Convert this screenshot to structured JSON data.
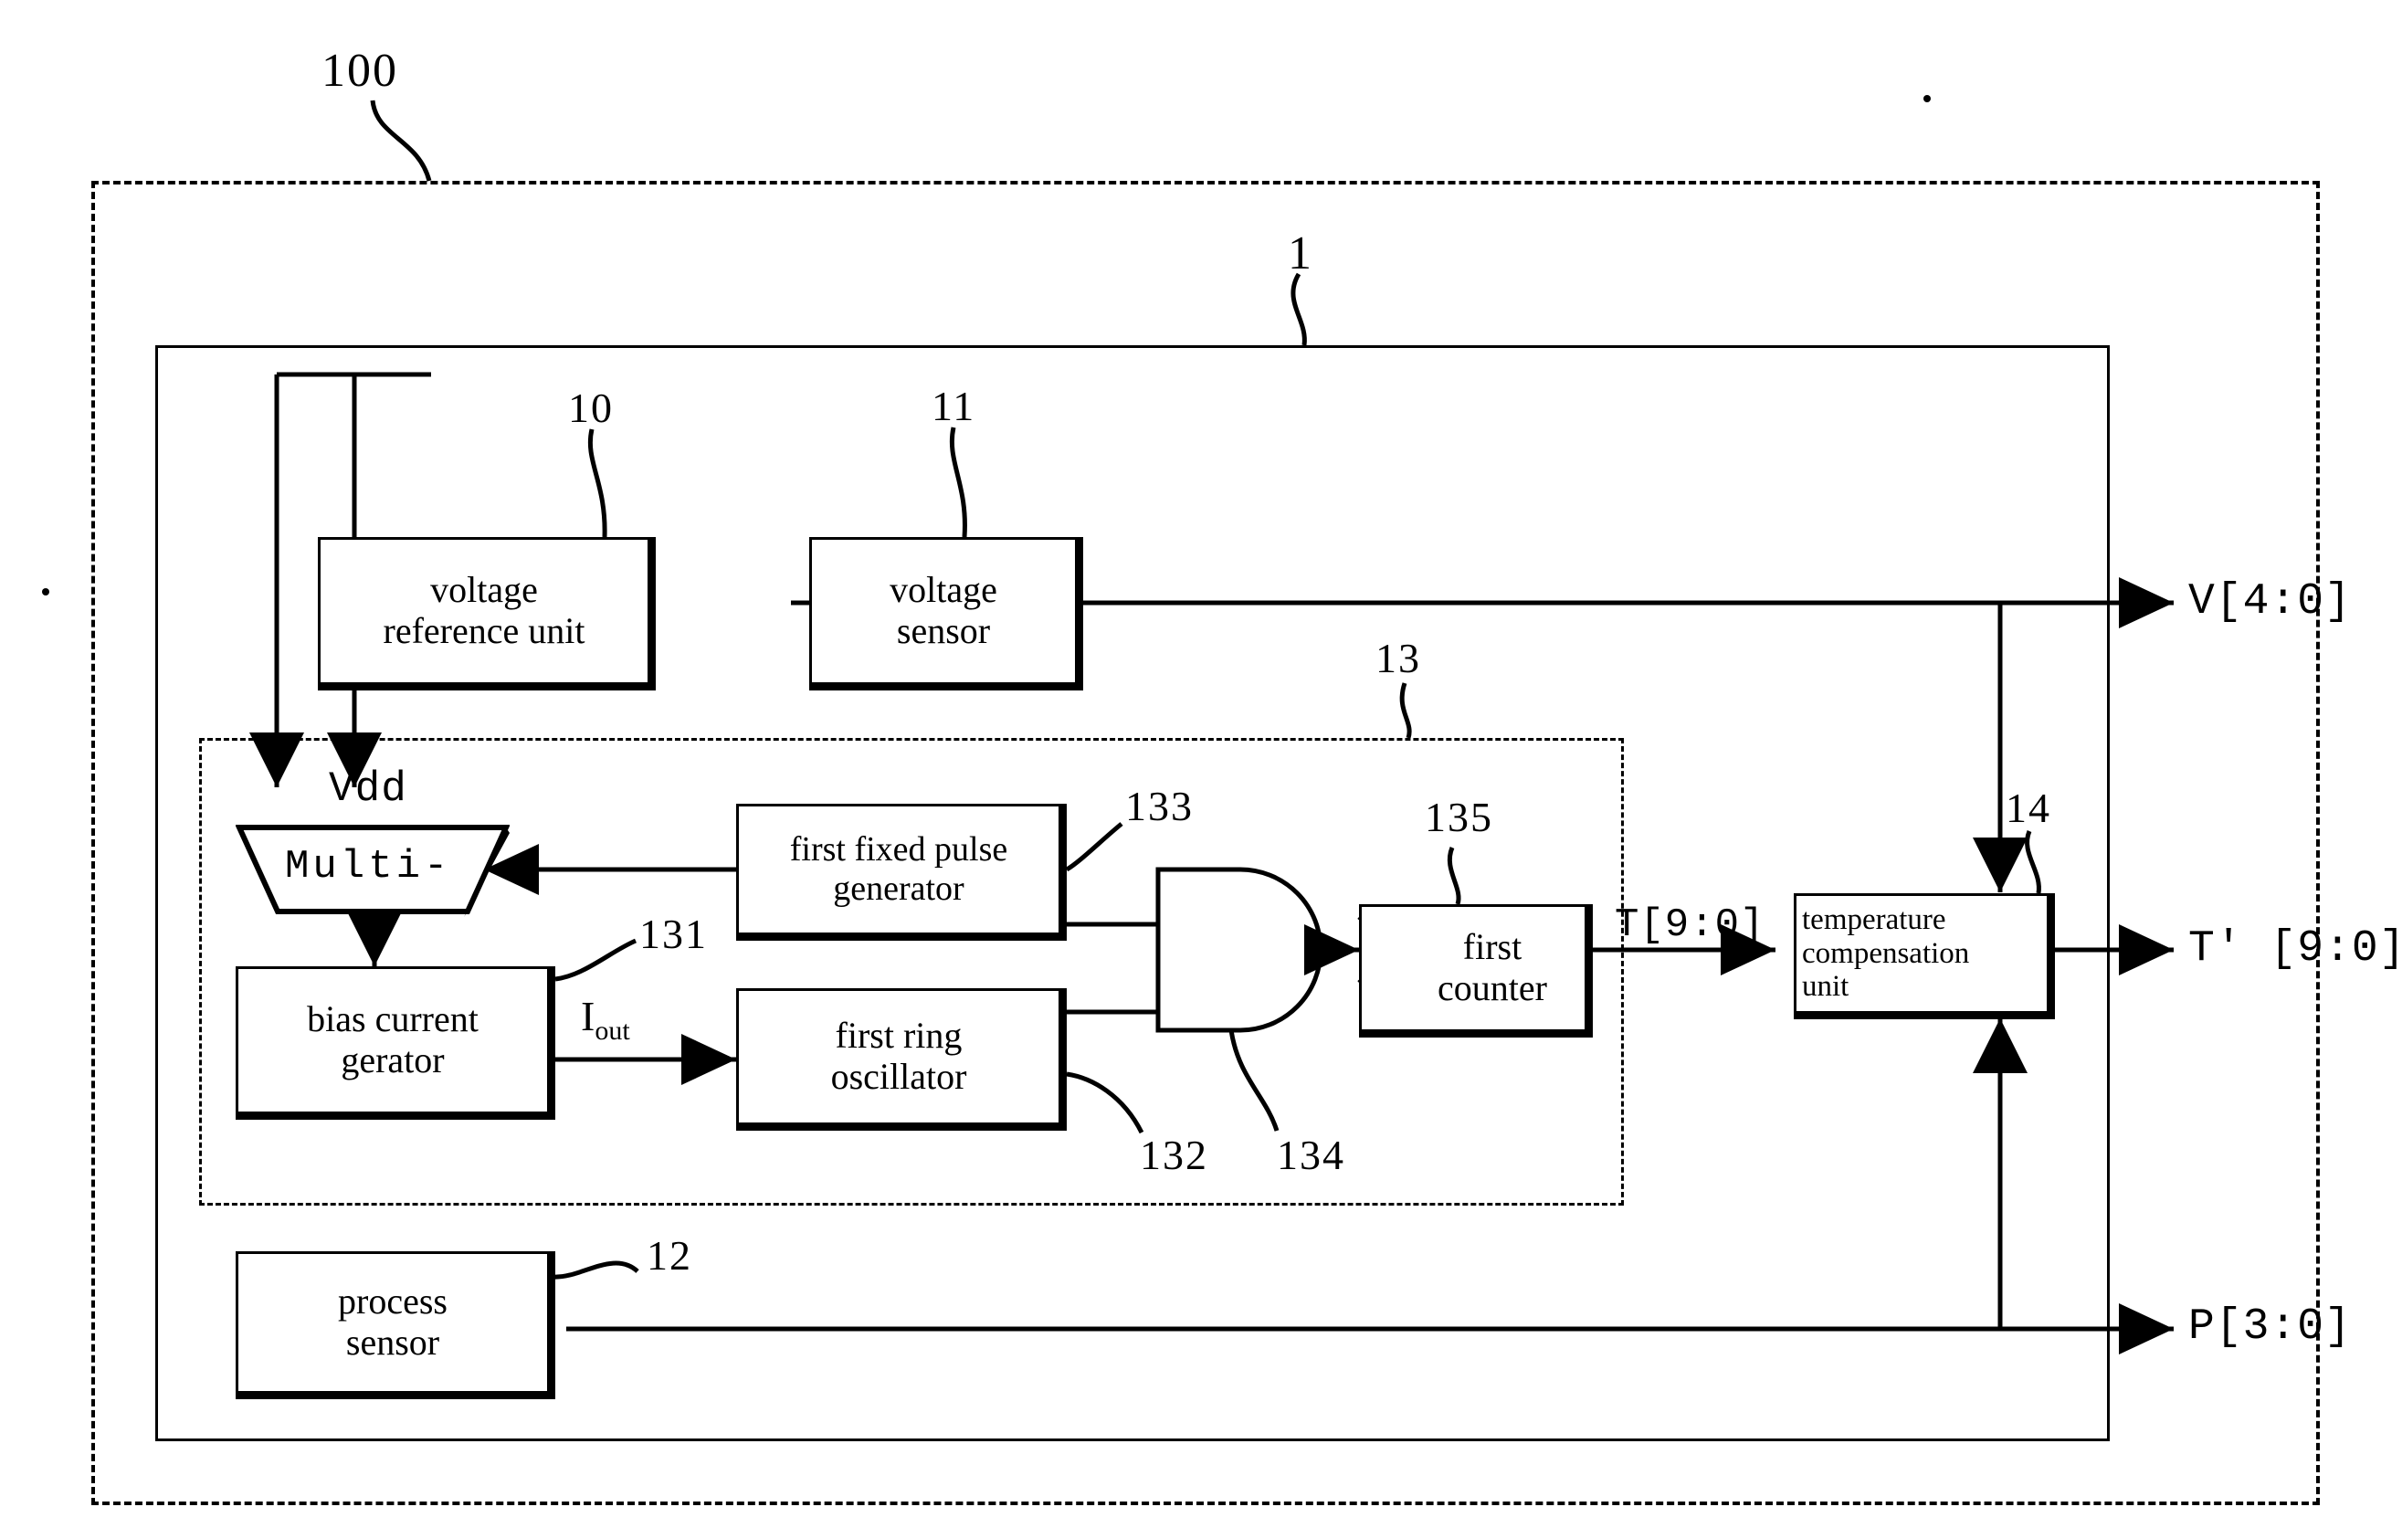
{
  "figure": {
    "type": "patent-block-diagram",
    "reference_numerals": {
      "system": "100",
      "chip": "1",
      "voltage_reference_unit": "10",
      "voltage_sensor": "11",
      "process_sensor": "12",
      "temperature_sensor_group": "13",
      "bias_current_generator": "131",
      "first_ring_oscillator": "132",
      "first_fixed_pulse_generator": "133",
      "and_gate": "134",
      "first_counter": "135",
      "temperature_compensation_unit": "14"
    },
    "blocks": [
      {
        "id": "voltage_reference_unit",
        "label": "voltage\nreference unit",
        "line1": "voltage",
        "line2": "reference unit",
        "ref": "10"
      },
      {
        "id": "voltage_sensor",
        "label": "voltage\nsensor",
        "line1": "voltage",
        "line2": "sensor",
        "ref": "11"
      },
      {
        "id": "multiplexer",
        "label": "Multi-",
        "ref": ""
      },
      {
        "id": "bias_current_generator",
        "label": "bias current\ngerator",
        "line1": "bias current",
        "line2": "gerator",
        "ref": "131"
      },
      {
        "id": "first_fixed_pulse_generator",
        "label": "first fixed pulse\ngenerator",
        "line1": "first fixed pulse",
        "line2": "generator",
        "ref": "133"
      },
      {
        "id": "first_ring_oscillator",
        "label": "first ring\noscillator",
        "line1": "first ring",
        "line2": "oscillator",
        "ref": "132"
      },
      {
        "id": "and_gate",
        "label": "AND",
        "ref": "134"
      },
      {
        "id": "first_counter",
        "label": "first\ncounter",
        "line1": "first",
        "line2": "counter",
        "ref": "135"
      },
      {
        "id": "temperature_compensation_unit",
        "label": "temperature\ncompensation\nunit",
        "line1": "temperature",
        "line2": "compensation",
        "line3": "unit",
        "ref": "14"
      },
      {
        "id": "process_sensor",
        "label": "process\nsensor",
        "line1": "process",
        "line2": "sensor",
        "ref": "12"
      }
    ],
    "signals": {
      "vdd": "Vdd",
      "i_out_base": "I",
      "i_out_sub": "out",
      "t_bus": "T[9:0]"
    },
    "outputs": [
      {
        "id": "voltage_output",
        "label": "V[4:0]"
      },
      {
        "id": "temperature_output",
        "label": "T' [9:0]"
      },
      {
        "id": "process_output",
        "label": "P[3:0]"
      }
    ],
    "colors": {
      "stroke": "#000000",
      "background": "#ffffff"
    }
  }
}
